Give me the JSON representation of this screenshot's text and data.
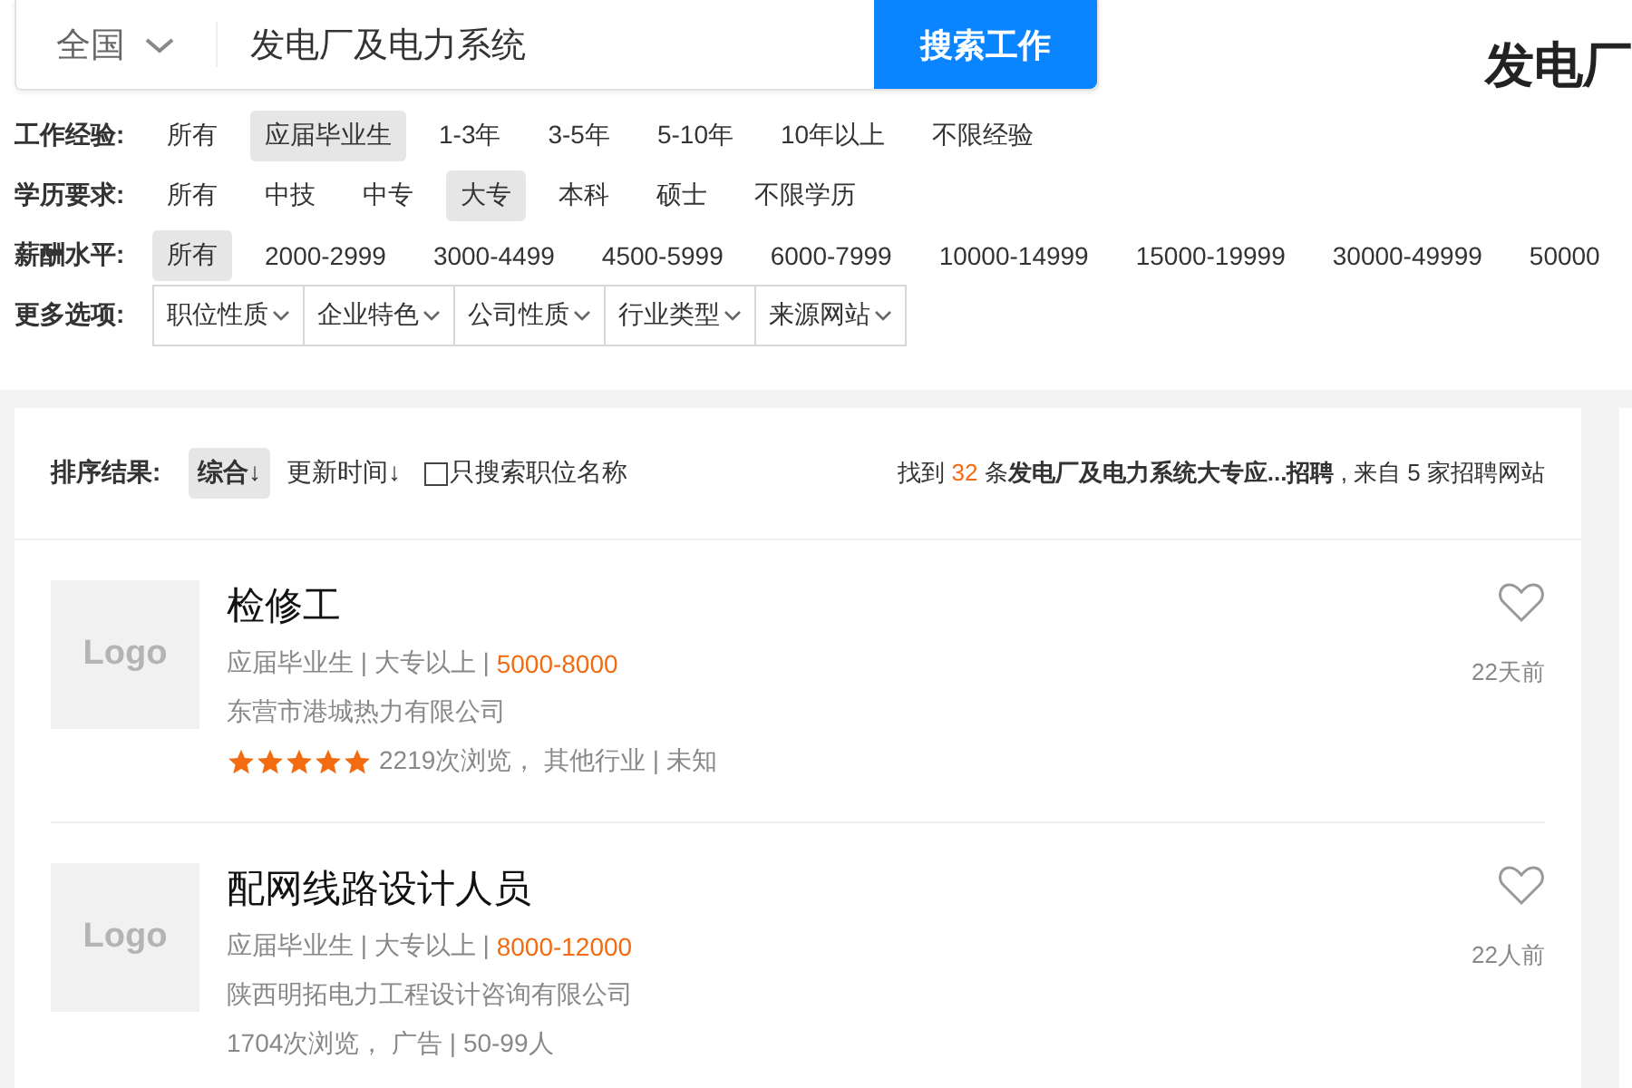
{
  "search": {
    "region": "全国",
    "query": "发电厂及电力系统",
    "button": "搜索工作"
  },
  "page_title": "发电厂",
  "filters": [
    {
      "label": "工作经验:",
      "options": [
        {
          "text": "所有",
          "selected": false
        },
        {
          "text": "应届毕业生",
          "selected": true
        },
        {
          "text": "1-3年",
          "selected": false
        },
        {
          "text": "3-5年",
          "selected": false
        },
        {
          "text": "5-10年",
          "selected": false
        },
        {
          "text": "10年以上",
          "selected": false
        },
        {
          "text": "不限经验",
          "selected": false
        }
      ]
    },
    {
      "label": "学历要求:",
      "options": [
        {
          "text": "所有",
          "selected": false
        },
        {
          "text": "中技",
          "selected": false
        },
        {
          "text": "中专",
          "selected": false
        },
        {
          "text": "大专",
          "selected": true
        },
        {
          "text": "本科",
          "selected": false
        },
        {
          "text": "硕士",
          "selected": false
        },
        {
          "text": "不限学历",
          "selected": false
        }
      ]
    },
    {
      "label": "薪酬水平:",
      "options": [
        {
          "text": "所有",
          "selected": true
        },
        {
          "text": "2000-2999",
          "selected": false
        },
        {
          "text": "3000-4499",
          "selected": false
        },
        {
          "text": "4500-5999",
          "selected": false
        },
        {
          "text": "6000-7999",
          "selected": false
        },
        {
          "text": "10000-14999",
          "selected": false
        },
        {
          "text": "15000-19999",
          "selected": false
        },
        {
          "text": "30000-49999",
          "selected": false
        },
        {
          "text": "50000",
          "selected": false
        }
      ]
    }
  ],
  "more": {
    "label": "更多选项:",
    "dropdowns": [
      "职位性质",
      "企业特色",
      "公司性质",
      "行业类型",
      "来源网站"
    ]
  },
  "sort": {
    "label": "排序结果:",
    "options": [
      {
        "text": "综合↓",
        "selected": true
      },
      {
        "text": "更新时间↓",
        "selected": false
      }
    ],
    "title_only": {
      "label": "只搜索职位名称",
      "checked": false
    }
  },
  "summary": {
    "prefix": "找到 ",
    "count": "32",
    "rest": " 条**发电厂及电力系统大专应...招聘** , 来自 5 家招聘网站"
  },
  "jobs": [
    {
      "logo": "Logo",
      "title": "检修工",
      "meta": "应届毕业生 | 大专以上 | ",
      "salary": "5000-8000",
      "company": "东营市港城热力有限公司",
      "stars": 5,
      "stats": "2219次浏览， 其他行业 | 未知",
      "time": "22天前"
    },
    {
      "logo": "Logo",
      "title": "配网线路设计人员",
      "meta": "应届毕业生 | 大专以上 | ",
      "salary": "8000-12000",
      "company": "陕西明拓电力工程设计咨询有限公司",
      "stars": 0,
      "stats": "1704次浏览， 广告 | 50-99人",
      "time": "22人前"
    }
  ]
}
